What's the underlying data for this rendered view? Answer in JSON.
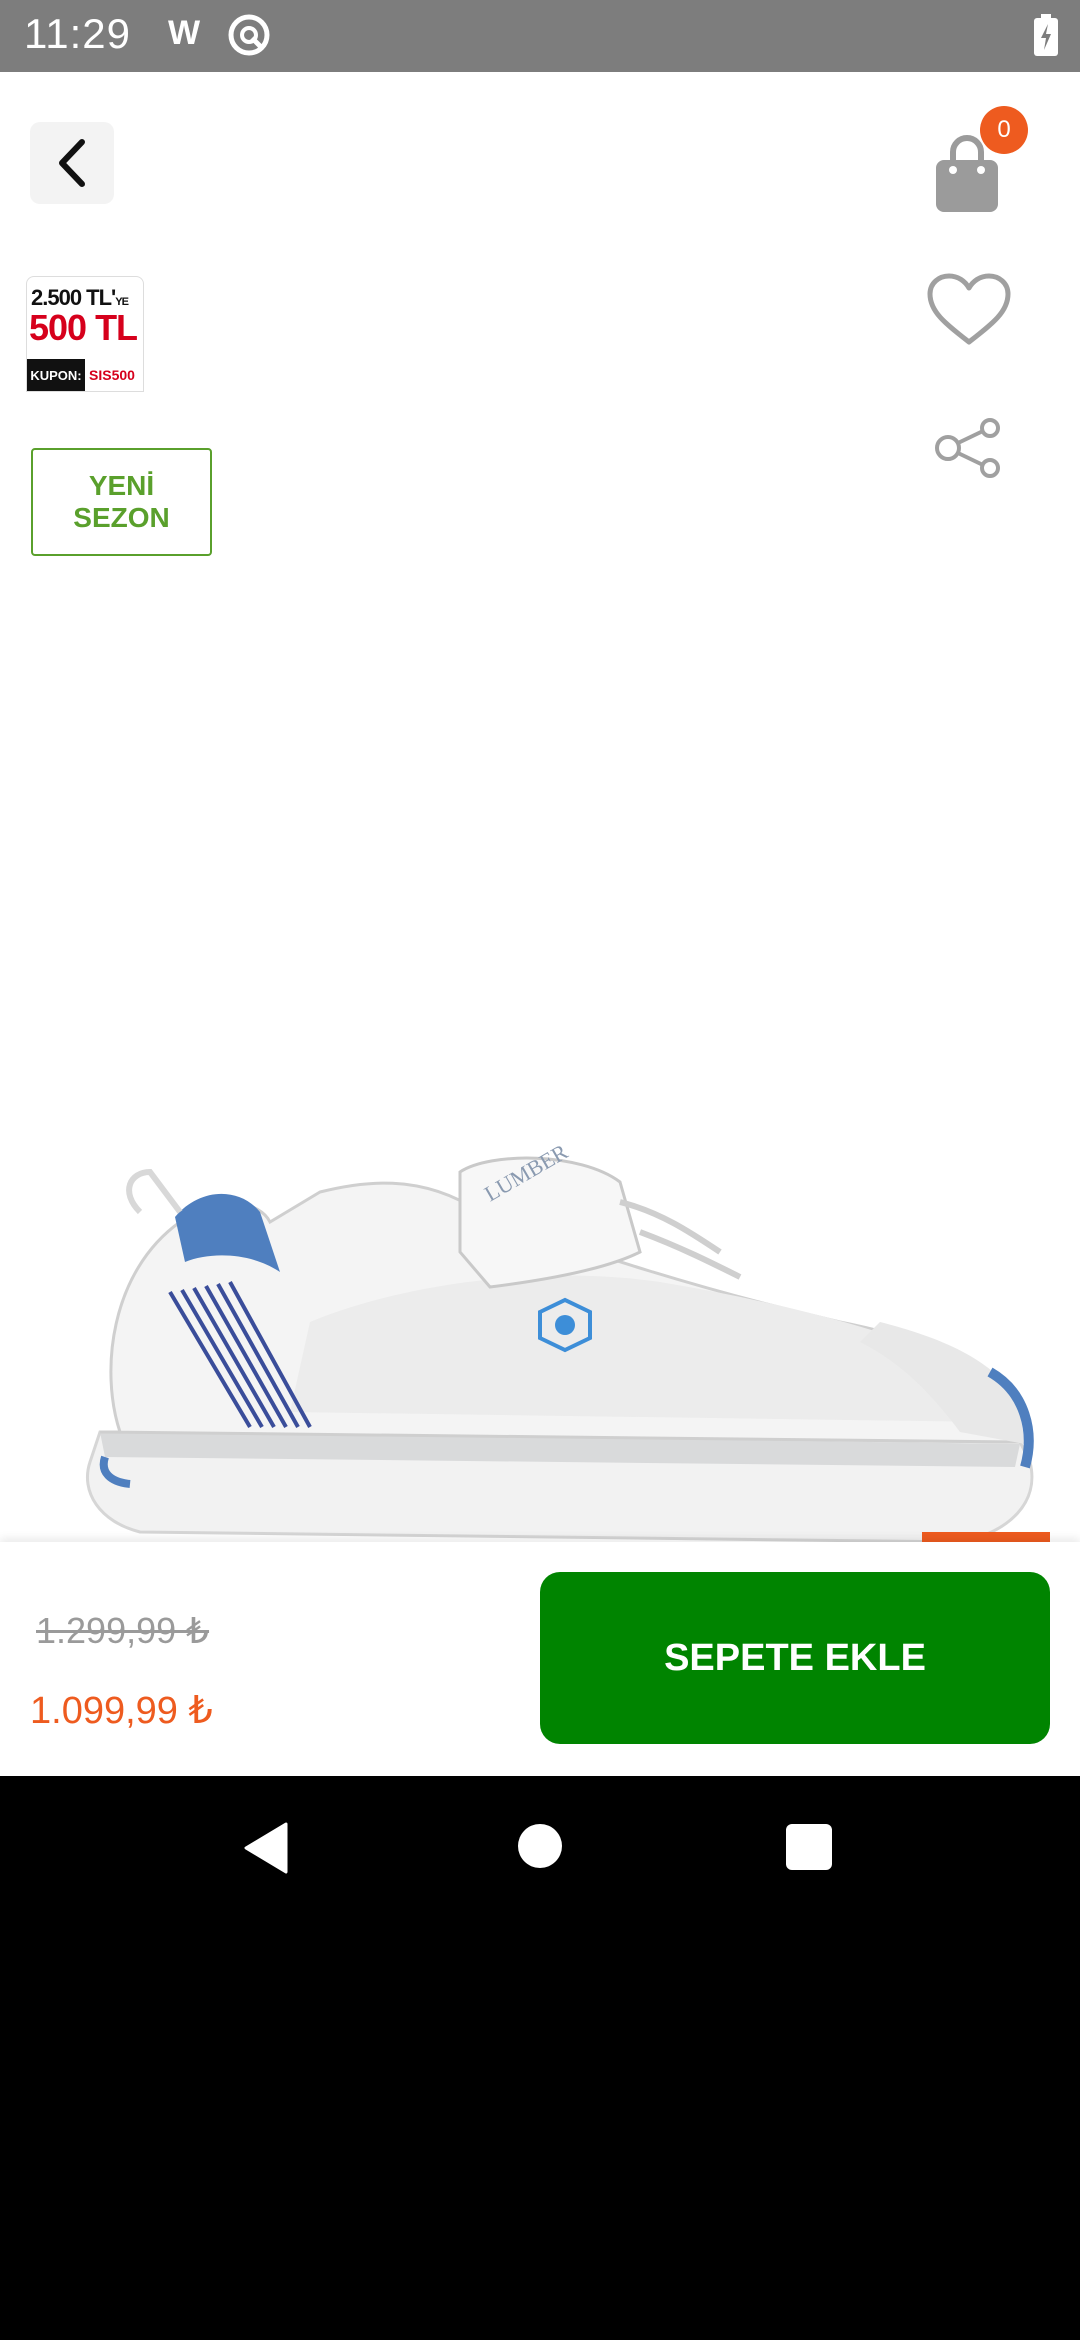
{
  "status": {
    "time": "11:29",
    "w": "W"
  },
  "header": {
    "cart_count": "0"
  },
  "promo": {
    "top": "2.500 TL'",
    "top_suffix": "YE",
    "big": "500 TL",
    "kupon_label": "KUPON:",
    "kupon_code": "SIS500",
    "new_season_line1": "YENİ",
    "new_season_line2": "SEZON"
  },
  "product": {
    "brand_on_shoe": "LUMBER"
  },
  "pricing": {
    "old_price": "1.299,99 ₺",
    "new_price": "1.099,99 ₺",
    "add_to_cart": "SEPETE EKLE"
  },
  "colors": {
    "accent": "#ee5b1f",
    "cta": "#008400",
    "badge": "#5aa02c"
  },
  "icons": [
    "back-icon",
    "cart-icon",
    "heart-icon",
    "share-icon",
    "nav-back-icon",
    "nav-home-icon",
    "nav-recent-icon",
    "battery-icon",
    "q-icon"
  ]
}
